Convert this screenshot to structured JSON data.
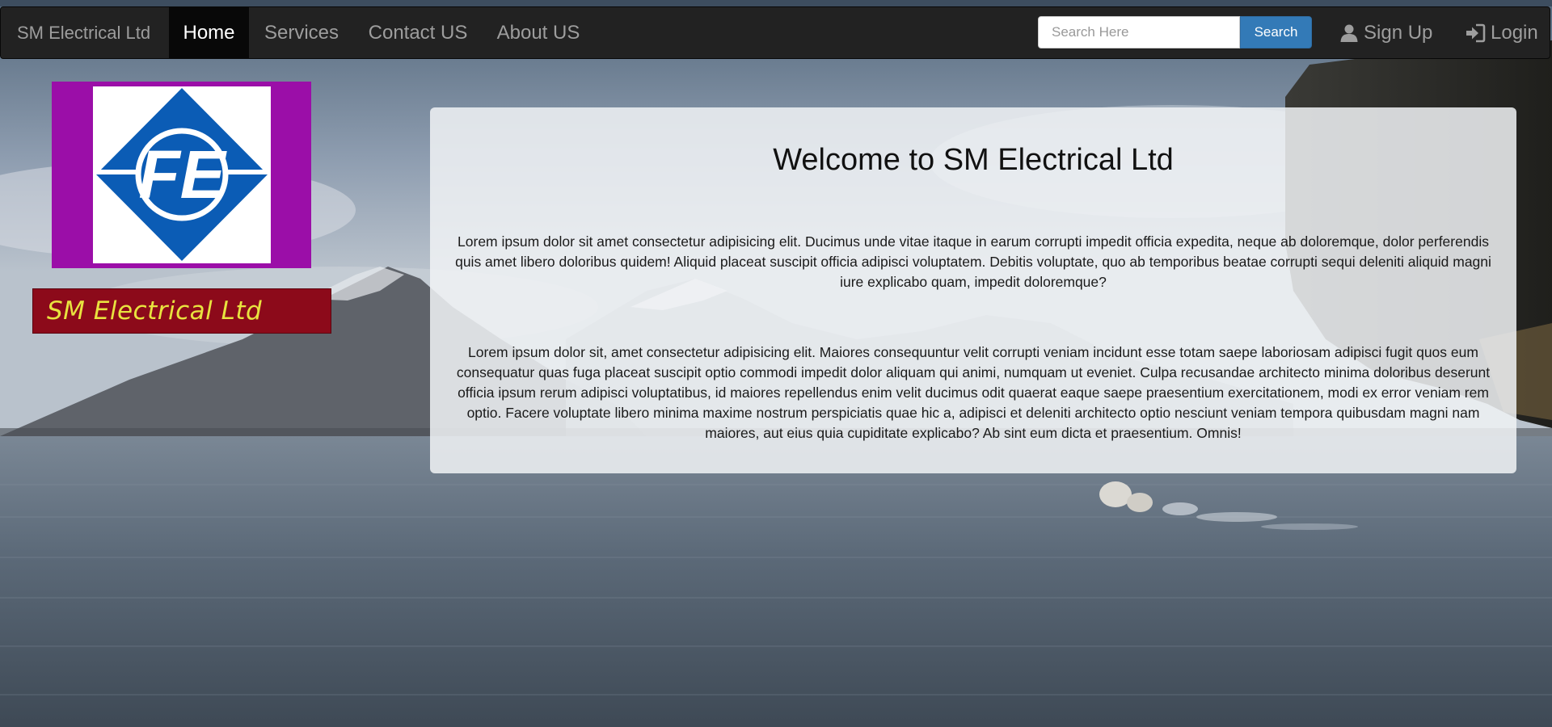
{
  "navbar": {
    "brand": "SM Electrical Ltd",
    "items": [
      {
        "label": "Home",
        "active": true
      },
      {
        "label": "Services",
        "active": false
      },
      {
        "label": "Contact US",
        "active": false
      },
      {
        "label": "About US",
        "active": false
      }
    ],
    "search": {
      "placeholder": "Search Here",
      "value": "",
      "button_label": "Search"
    },
    "signup_label": "Sign Up",
    "login_label": "Login",
    "icons": {
      "signup": "user-icon",
      "login": "log-in-icon"
    }
  },
  "logo": {
    "text": "FE"
  },
  "company_banner": "SM Electrical Ltd",
  "welcome": {
    "title": "Welcome to SM Electrical Ltd",
    "paragraph1": "Lorem ipsum dolor sit amet consectetur adipisicing elit. Ducimus unde vitae itaque in earum corrupti impedit officia expedita, neque ab doloremque, dolor perferendis quis amet libero doloribus quidem! Aliquid placeat suscipit officia adipisci voluptatem. Debitis voluptate, quo ab temporibus beatae corrupti sequi deleniti aliquid magni iure explicabo quam, impedit doloremque?",
    "paragraph2": "Lorem ipsum dolor sit, amet consectetur adipisicing elit. Maiores consequuntur velit corrupti veniam incidunt esse totam saepe laboriosam adipisci fugit quos eum consequatur quas fuga placeat suscipit optio commodi impedit dolor aliquam qui animi, numquam ut eveniet. Culpa recusandae architecto minima doloribus deserunt officia ipsum rerum adipisci voluptatibus, id maiores repellendus enim velit ducimus odit quaerat eaque saepe praesentium exercitationem, modi ex error veniam rem optio. Facere voluptate libero minima maxime nostrum perspiciatis quae hic a, adipisci et deleniti architecto optio nesciunt veniam tempora quibusdam magni nam maiores, aut eius quia cupiditate explicabo? Ab sint eum dicta et praesentium. Omnis!"
  },
  "colors": {
    "navbar": "#222222",
    "active_nav": "#080808",
    "search_button": "#337ab7",
    "logo_frame": "#9b0ea8",
    "logo_blue": "#0b5cb5",
    "banner_bg": "#8c0a1a",
    "banner_text": "#e8e33f"
  }
}
